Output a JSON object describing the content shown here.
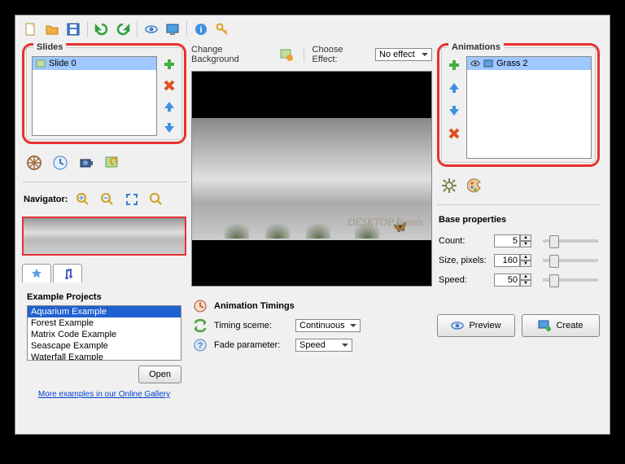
{
  "slides": {
    "title": "Slides",
    "items": [
      "Slide 0"
    ]
  },
  "animations": {
    "title": "Animations",
    "items": [
      "Grass 2"
    ]
  },
  "navigator": {
    "label": "Navigator:"
  },
  "changeBg": {
    "label": "Change Background"
  },
  "chooseEffect": {
    "label": "Choose Effect:",
    "value": "No effect"
  },
  "examples": {
    "title": "Example Projects",
    "items": [
      "Aquarium Example",
      "Forest Example",
      "Matrix Code Example",
      "Seascape Example",
      "Waterfall Example"
    ],
    "openBtn": "Open",
    "link": "More examples in our Online Gallery"
  },
  "timings": {
    "title": "Animation Timings",
    "scemeLabel": "Timing sceme:",
    "scemeValue": "Continuous",
    "fadeLabel": "Fade parameter:",
    "fadeValue": "Speed"
  },
  "baseProps": {
    "title": "Base properties",
    "count": {
      "label": "Count:",
      "value": "5"
    },
    "size": {
      "label": "Size, pixels:",
      "value": "160"
    },
    "speed": {
      "label": "Speed:",
      "value": "50"
    }
  },
  "watermark": "DESKTOP Paints",
  "buttons": {
    "preview": "Preview",
    "create": "Create"
  }
}
